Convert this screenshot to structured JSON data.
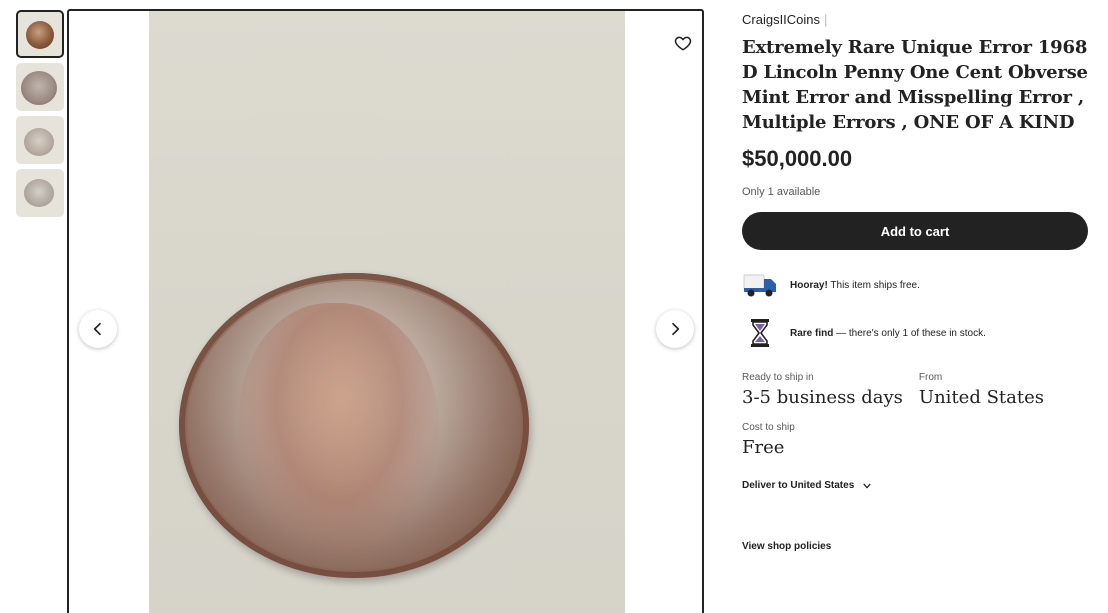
{
  "gallery": {
    "thumbnails": [
      "thumbnail-1",
      "thumbnail-2",
      "thumbnail-3",
      "thumbnail-4"
    ],
    "favorite_icon": "heart-icon",
    "prev_icon": "chevron-left-icon",
    "next_icon": "chevron-right-icon"
  },
  "listing": {
    "shop_name": "CraigsIICoins",
    "shop_separator": "|",
    "title": "Extremely Rare Unique Error 1968 D Lincoln Penny One Cent Obverse Mint Error and Misspelling Error , Multiple Errors , ONE OF A KIND",
    "price": "$50,000.00",
    "stock_text": "Only 1 available",
    "add_to_cart_label": "Add to cart"
  },
  "perks": {
    "shipping_bold": "Hooray!",
    "shipping_text": " This item ships free.",
    "rare_bold": "Rare find",
    "rare_text": " — there's only 1 of these in stock."
  },
  "shipping": {
    "ready_label": "Ready to ship in",
    "ready_value": "3-5 business days",
    "from_label": "From",
    "from_value": "United States",
    "cost_label": "Cost to ship",
    "cost_value": "Free",
    "deliver_label": "Deliver to United States",
    "policies_label": "View shop policies"
  },
  "colors": {
    "primary_button": "#222222",
    "text": "#222222",
    "muted": "#595959",
    "truck_blue": "#2b5fad",
    "hourglass_purple": "#7b5fa8"
  }
}
